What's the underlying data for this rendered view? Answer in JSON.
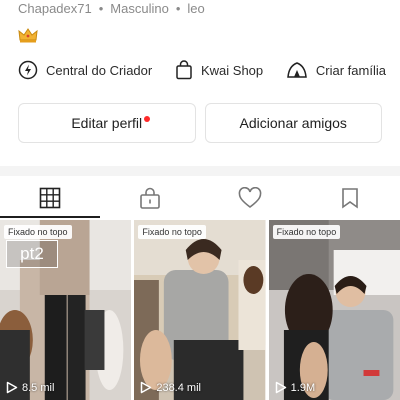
{
  "profile": {
    "username": "Chapadex71",
    "gender": "Masculino",
    "sign": "leo",
    "separator": "•"
  },
  "quick_links": [
    {
      "label": "Central do Criador",
      "icon": "lightning-icon"
    },
    {
      "label": "Kwai Shop",
      "icon": "shopping-bag-icon"
    },
    {
      "label": "Criar família",
      "icon": "tent-icon"
    }
  ],
  "actions": {
    "edit_profile": "Editar perfil",
    "add_friends": "Adicionar amigos"
  },
  "tabs": [
    {
      "name": "grid",
      "icon": "grid-icon",
      "active": true
    },
    {
      "name": "private",
      "icon": "lock-icon",
      "active": false
    },
    {
      "name": "liked",
      "icon": "heart-icon",
      "active": false
    },
    {
      "name": "saved",
      "icon": "bookmark-icon",
      "active": false
    }
  ],
  "videos": [
    {
      "pinned_label": "Fixado no topo",
      "views": "8.5 mil",
      "caption": "pt2"
    },
    {
      "pinned_label": "Fixado no topo",
      "views": "238.4 mil"
    },
    {
      "pinned_label": "Fixado no topo",
      "views": "1.9M"
    }
  ],
  "colors": {
    "accent_dot": "#ff2a2a",
    "muted_text": "#8a8a8a",
    "crown": "#f2b233"
  }
}
